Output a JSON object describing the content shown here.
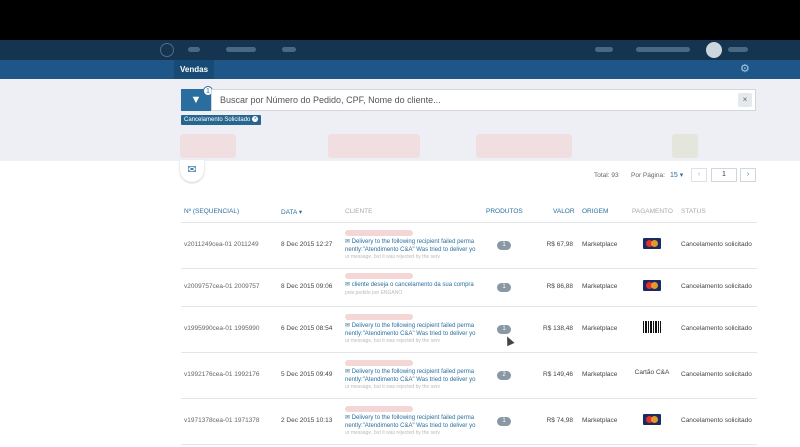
{
  "subnav": {
    "tab_label": "Vendas"
  },
  "search": {
    "placeholder": "Buscar por Número do Pedido, CPF, Nome do cliente...",
    "filter_count": "1",
    "clear": "×"
  },
  "filters": {
    "active_chip": "Cancelamento Solicitado"
  },
  "pagination": {
    "total": "Total: 93",
    "per_page_label": "Por Página:",
    "per_page_value": "15 ▾",
    "prev": "‹",
    "page": "1",
    "next": "›"
  },
  "table": {
    "headers": {
      "sequencial": "Nº (SEQUENCIAL)",
      "data": "DATA ▾",
      "cliente": "CLIENTE",
      "produtos": "PRODUTOS",
      "valor": "VALOR",
      "origem": "ORIGEM",
      "pagamento": "PAGAMENTO",
      "status": "STATUS"
    },
    "rows": [
      {
        "id": "v2011249cea-01 2011249",
        "date": "8 Dec 2015 12:27",
        "msg1": "✉ Delivery to the following recipient failed perma",
        "msg2": "nently:\"Atendimento C&A\" Was tried to deliver yo",
        "msg3": "ur message, but it was rejected by the serv",
        "products": "1",
        "value": "R$ 67,98",
        "origin": "Marketplace",
        "payment": "mastercard",
        "status": "Cancelamento solicitado"
      },
      {
        "id": "v2009757cea-01 2009757",
        "date": "8 Dec 2015 09:06",
        "msg1": "✉ cliente deseja o cancelamento da sua compra",
        "msg2": "pois pedido por ENGANO",
        "msg3": "",
        "products": "1",
        "value": "R$ 86,88",
        "origin": "Marketplace",
        "payment": "mastercard",
        "status": "Cancelamento solicitado"
      },
      {
        "id": "v1995990cea-01 1995990",
        "date": "6 Dec 2015 08:54",
        "msg1": "✉ Delivery to the following recipient failed perma",
        "msg2": "nently:\"Atendimento C&A\" Was tried to deliver yo",
        "msg3": "ur message, but it was rejected by the serv",
        "products": "1",
        "value": "R$ 138,48",
        "origin": "Marketplace",
        "payment": "boleto",
        "status": "Cancelamento solicitado"
      },
      {
        "id": "v1992176cea-01 1992176",
        "date": "5 Dec 2015 09:49",
        "msg1": "✉ Delivery to the following recipient failed perma",
        "msg2": "nently:\"Atendimento C&A\" Was tried to deliver yo",
        "msg3": "ur message, but it was rejected by the serv",
        "products": "2",
        "value": "R$ 149,46",
        "origin": "Marketplace",
        "payment": "Cartão C&A",
        "status": "Cancelamento solicitado"
      },
      {
        "id": "v1971378cea-01 1971378",
        "date": "2 Dec 2015 10:13",
        "msg1": "✉ Delivery to the following recipient failed perma",
        "msg2": "nently:\"Atendimento C&A\" Was tried to deliver yo",
        "msg3": "ur message, but it was rejected by the serv",
        "products": "1",
        "value": "R$ 74,98",
        "origin": "Marketplace",
        "payment": "mastercard",
        "status": "Cancelamento solicitado"
      }
    ]
  },
  "icons": {
    "filter": "filter-icon",
    "gear": "gear-icon",
    "mail": "envelope-icon",
    "close": "close-icon"
  },
  "colors": {
    "nav_dark": "#14344f",
    "subnav": "#1e5787",
    "accent": "#296e9e",
    "band": "#edeff4"
  }
}
